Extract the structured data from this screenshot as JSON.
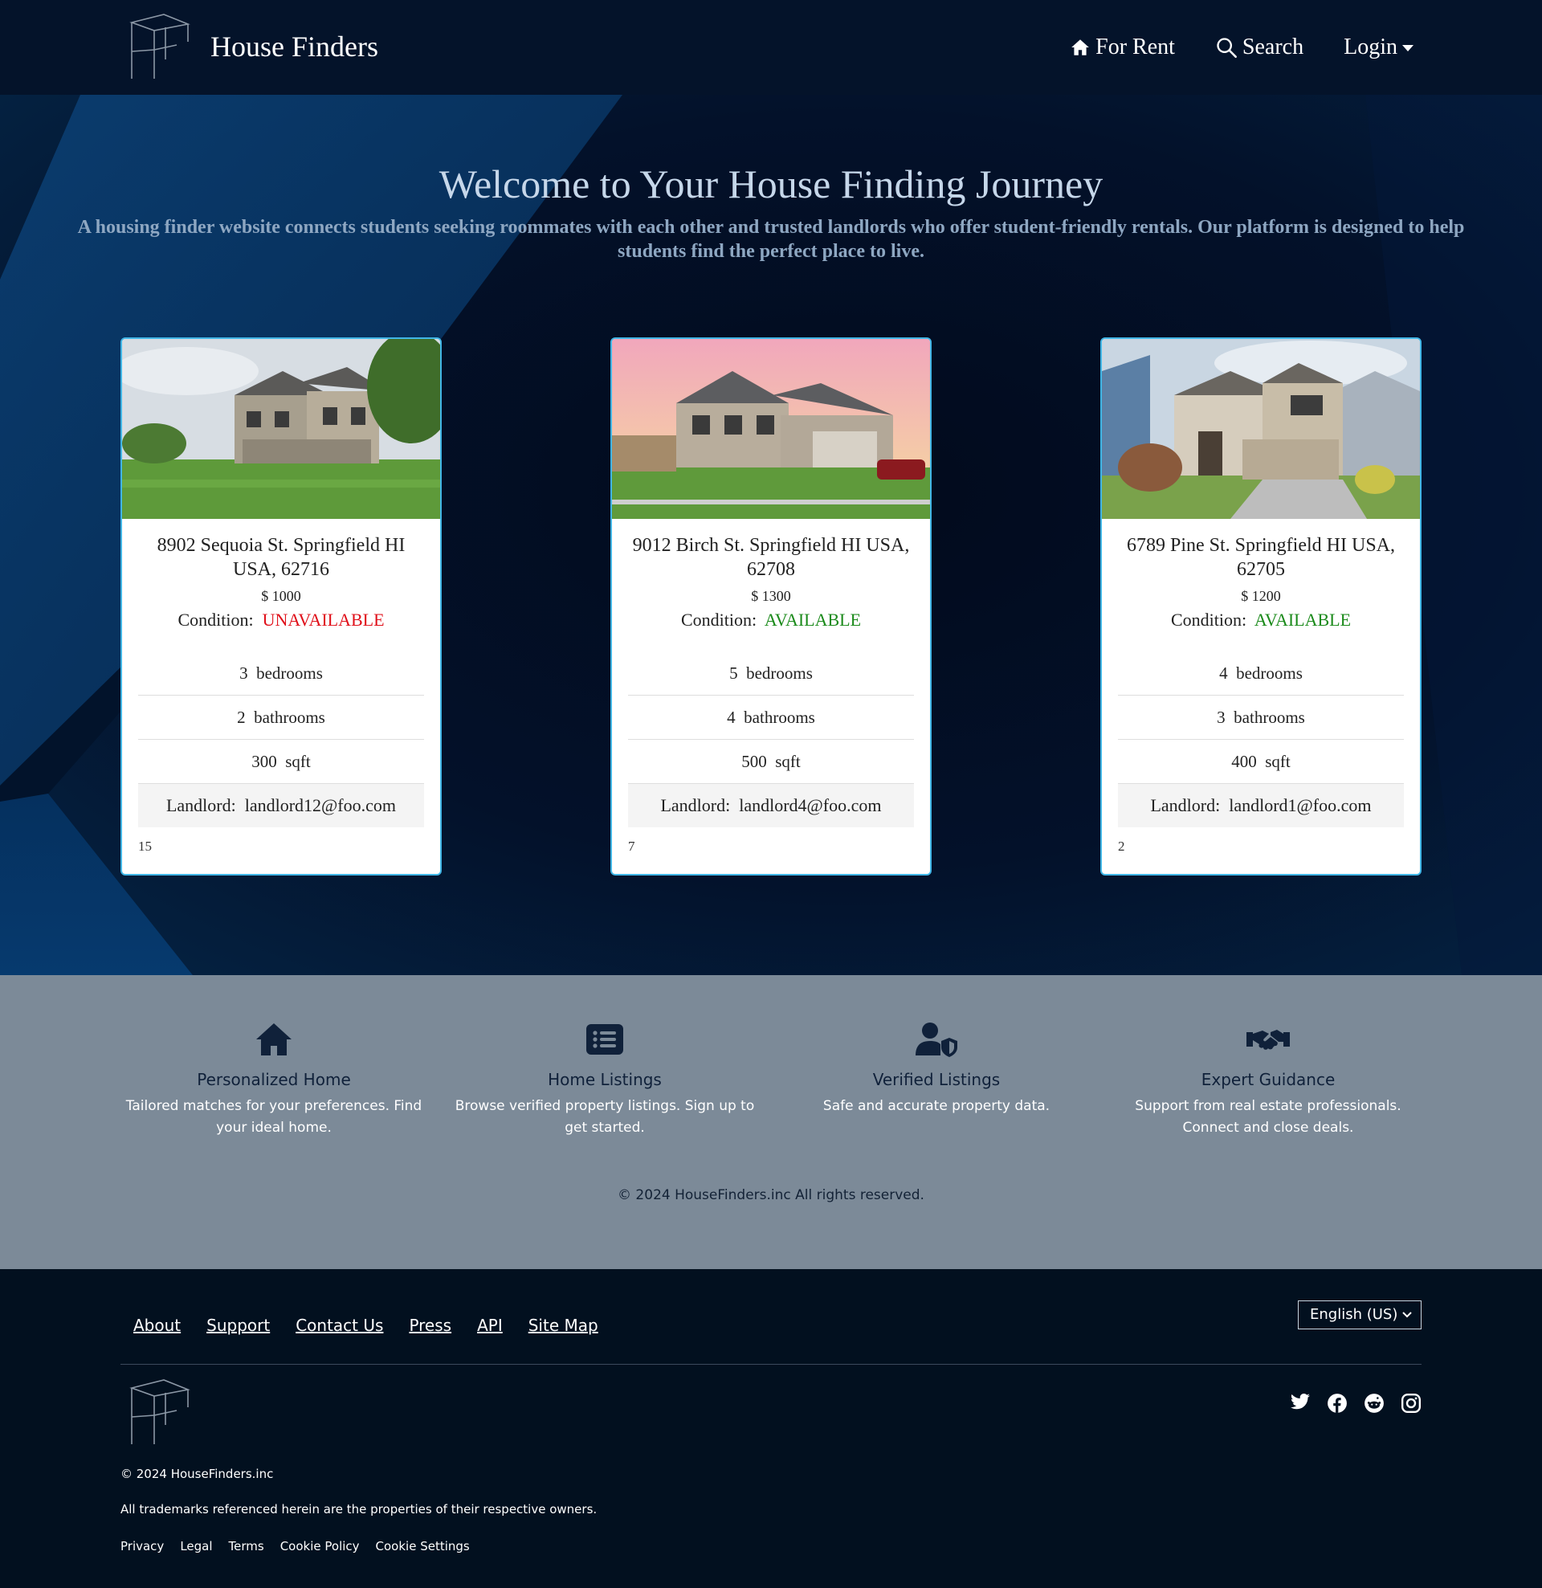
{
  "navbar": {
    "brand": "House Finders",
    "items": [
      {
        "label": "For Rent",
        "icon": "house-icon"
      },
      {
        "label": "Search",
        "icon": "search-icon"
      },
      {
        "label": "Login",
        "icon": "caret-down-icon"
      }
    ]
  },
  "hero": {
    "title": "Welcome to Your House Finding Journey",
    "subtitle": "A housing finder website connects students seeking roommates with each other and trusted landlords who offer student-friendly rentals. Our platform is designed to help students find the perfect place to live."
  },
  "listings": [
    {
      "address": "8902 Sequoia St. Springfield HI USA, 62716",
      "price": "$ 1000",
      "condition_label": "Condition:",
      "condition": "UNAVAILABLE",
      "bedrooms": "3",
      "bedrooms_label": "bedrooms",
      "bathrooms": "2",
      "bathrooms_label": "bathrooms",
      "sqft": "300",
      "sqft_label": "sqft",
      "landlord_label": "Landlord:",
      "landlord": "landlord12@foo.com",
      "id": "15"
    },
    {
      "address": "9012 Birch St. Springfield HI USA, 62708",
      "price": "$ 1300",
      "condition_label": "Condition:",
      "condition": "AVAILABLE",
      "bedrooms": "5",
      "bedrooms_label": "bedrooms",
      "bathrooms": "4",
      "bathrooms_label": "bathrooms",
      "sqft": "500",
      "sqft_label": "sqft",
      "landlord_label": "Landlord:",
      "landlord": "landlord4@foo.com",
      "id": "7"
    },
    {
      "address": "6789 Pine St. Springfield HI USA, 62705",
      "price": "$ 1200",
      "condition_label": "Condition:",
      "condition": "AVAILABLE",
      "bedrooms": "4",
      "bedrooms_label": "bedrooms",
      "bathrooms": "3",
      "bathrooms_label": "bathrooms",
      "sqft": "400",
      "sqft_label": "sqft",
      "landlord_label": "Landlord:",
      "landlord": "landlord1@foo.com",
      "id": "2"
    }
  ],
  "features": {
    "items": [
      {
        "icon": "house-icon",
        "title": "Personalized Home",
        "desc": "Tailored matches for your preferences. Find your ideal home."
      },
      {
        "icon": "list-icon",
        "title": "Home Listings",
        "desc": "Browse verified property listings. Sign up to get started."
      },
      {
        "icon": "user-shield-icon",
        "title": "Verified Listings",
        "desc": "Safe and accurate property data."
      },
      {
        "icon": "handshake-icon",
        "title": "Expert Guidance",
        "desc": "Support from real estate professionals. Connect and close deals."
      }
    ],
    "copyright": "© 2024 HouseFinders.inc All rights reserved."
  },
  "footer": {
    "links": [
      "About",
      "Support",
      "Contact Us",
      "Press",
      "API",
      "Site Map"
    ],
    "language": "English (US)",
    "social": [
      "twitter-icon",
      "facebook-icon",
      "reddit-icon",
      "instagram-icon"
    ],
    "copyright": "© 2024 HouseFinders.inc",
    "trademark": "All trademarks referenced herein are the properties of their respective owners.",
    "legal": [
      "Privacy",
      "Legal",
      "Terms",
      "Cookie Policy",
      "Cookie Settings"
    ]
  },
  "colors": {
    "navbar_bg": "#04132a",
    "card_border": "#41b6e6",
    "available": "#1a8a1a",
    "unavailable": "#e0101a",
    "features_bg": "#7c8a98",
    "footer_bg": "#02101f"
  }
}
